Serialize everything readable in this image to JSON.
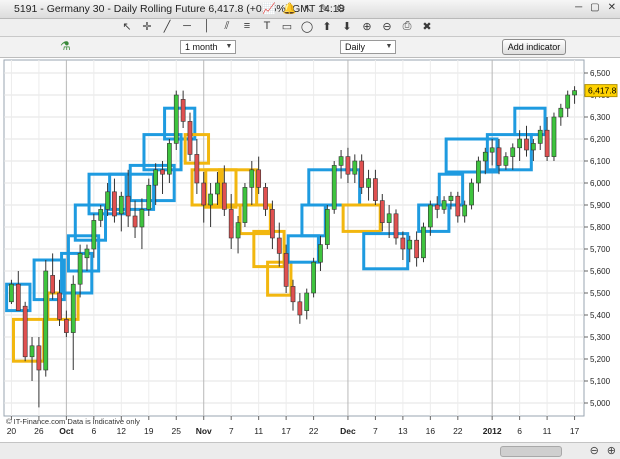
{
  "window": {
    "title": "5191 - Germany 30 - Daily Rolling Future   6,417.8 (+0.05%)   GMT 14:18",
    "close_glyph": "✕",
    "maximize_glyph": "▢",
    "minimize_glyph": "─"
  },
  "toolbar": {
    "period_select": "1 month",
    "interval_select": "Daily",
    "add_indicator_label": "Add indicator"
  },
  "footer": {
    "source_label": "© IT-Finance.com  Data is indicative only"
  },
  "chart_data": {
    "type": "candlestick",
    "last_price_label": "6,417.8",
    "ylim": [
      4950,
      6550
    ],
    "yticks": [
      "6,500",
      "6,400",
      "6,300",
      "6,200",
      "6,100",
      "6,000",
      "5,900",
      "5,800",
      "5,700",
      "5,600",
      "5,500",
      "5,400",
      "5,300",
      "5,200",
      "5,100",
      "5,000"
    ],
    "ytick_values": [
      6500,
      6400,
      6300,
      6200,
      6100,
      6000,
      5900,
      5800,
      5700,
      5600,
      5500,
      5400,
      5300,
      5200,
      5100,
      5000
    ],
    "xticks": [
      "20",
      "26",
      "Oct",
      "6",
      "12",
      "19",
      "25",
      "Nov",
      "7",
      "11",
      "17",
      "22",
      "Dec",
      "7",
      "13",
      "16",
      "22",
      "2012",
      "6",
      "11",
      "17"
    ],
    "xtick_index": [
      0,
      4,
      8,
      12,
      16,
      20,
      24,
      28,
      32,
      36,
      40,
      44,
      49,
      53,
      57,
      61,
      65,
      70,
      74,
      78,
      82
    ],
    "candles": [
      [
        5460,
        5560,
        5450,
        5540
      ],
      [
        5540,
        5600,
        5420,
        5420
      ],
      [
        5440,
        5460,
        5190,
        5210
      ],
      [
        5210,
        5300,
        5100,
        5260
      ],
      [
        5260,
        5300,
        4980,
        5150
      ],
      [
        5150,
        5650,
        5120,
        5600
      ],
      [
        5580,
        5680,
        5470,
        5500
      ],
      [
        5500,
        5560,
        5350,
        5380
      ],
      [
        5380,
        5420,
        5300,
        5320
      ],
      [
        5320,
        5580,
        5150,
        5540
      ],
      [
        5540,
        5720,
        5480,
        5680
      ],
      [
        5660,
        5720,
        5600,
        5700
      ],
      [
        5700,
        5860,
        5660,
        5830
      ],
      [
        5830,
        5900,
        5800,
        5880
      ],
      [
        5880,
        6000,
        5850,
        5960
      ],
      [
        5960,
        6020,
        5820,
        5850
      ],
      [
        5860,
        5960,
        5780,
        5940
      ],
      [
        5940,
        6060,
        5800,
        5850
      ],
      [
        5850,
        5920,
        5750,
        5800
      ],
      [
        5800,
        5930,
        5700,
        5880
      ],
      [
        5880,
        6020,
        5850,
        5990
      ],
      [
        5990,
        6090,
        5900,
        6060
      ],
      [
        6060,
        6100,
        5950,
        6040
      ],
      [
        6040,
        6200,
        6000,
        6180
      ],
      [
        6180,
        6420,
        6150,
        6400
      ],
      [
        6380,
        6420,
        6250,
        6280
      ],
      [
        6280,
        6320,
        6100,
        6130
      ],
      [
        6130,
        6200,
        5950,
        6000
      ],
      [
        6000,
        6050,
        5820,
        5900
      ],
      [
        5900,
        6000,
        5800,
        5950
      ],
      [
        5950,
        6050,
        5900,
        6000
      ],
      [
        6000,
        6080,
        5850,
        5880
      ],
      [
        5880,
        5950,
        5700,
        5750
      ],
      [
        5750,
        5850,
        5680,
        5820
      ],
      [
        5820,
        6000,
        5800,
        5980
      ],
      [
        5980,
        6100,
        5900,
        6060
      ],
      [
        6060,
        6120,
        5950,
        5980
      ],
      [
        5980,
        6000,
        5850,
        5880
      ],
      [
        5880,
        5920,
        5700,
        5750
      ],
      [
        5750,
        5820,
        5620,
        5680
      ],
      [
        5680,
        5720,
        5500,
        5530
      ],
      [
        5530,
        5560,
        5420,
        5460
      ],
      [
        5460,
        5500,
        5360,
        5400
      ],
      [
        5420,
        5520,
        5380,
        5500
      ],
      [
        5500,
        5660,
        5480,
        5640
      ],
      [
        5640,
        5760,
        5600,
        5720
      ],
      [
        5720,
        5900,
        5700,
        5880
      ],
      [
        5880,
        6100,
        5860,
        6080
      ],
      [
        6080,
        6150,
        6020,
        6120
      ],
      [
        6120,
        6160,
        6000,
        6040
      ],
      [
        6040,
        6130,
        6000,
        6100
      ],
      [
        6100,
        6130,
        5950,
        5980
      ],
      [
        5980,
        6060,
        5920,
        6020
      ],
      [
        6020,
        6060,
        5900,
        5920
      ],
      [
        5920,
        5950,
        5780,
        5820
      ],
      [
        5820,
        5900,
        5750,
        5860
      ],
      [
        5860,
        5880,
        5720,
        5750
      ],
      [
        5750,
        5780,
        5650,
        5700
      ],
      [
        5700,
        5760,
        5640,
        5740
      ],
      [
        5740,
        5780,
        5620,
        5660
      ],
      [
        5660,
        5820,
        5640,
        5800
      ],
      [
        5800,
        5920,
        5760,
        5900
      ],
      [
        5900,
        5940,
        5840,
        5880
      ],
      [
        5880,
        5940,
        5860,
        5920
      ],
      [
        5920,
        5960,
        5880,
        5940
      ],
      [
        5940,
        5960,
        5820,
        5850
      ],
      [
        5850,
        5920,
        5820,
        5900
      ],
      [
        5900,
        6020,
        5880,
        6000
      ],
      [
        6000,
        6120,
        5960,
        6100
      ],
      [
        6100,
        6160,
        6040,
        6140
      ],
      [
        6140,
        6200,
        6080,
        6160
      ],
      [
        6160,
        6200,
        6040,
        6080
      ],
      [
        6080,
        6140,
        6060,
        6120
      ],
      [
        6120,
        6180,
        6060,
        6160
      ],
      [
        6160,
        6240,
        6100,
        6200
      ],
      [
        6200,
        6260,
        6120,
        6150
      ],
      [
        6150,
        6200,
        6100,
        6180
      ],
      [
        6180,
        6260,
        6150,
        6240
      ],
      [
        6240,
        6300,
        6100,
        6120
      ],
      [
        6120,
        6320,
        6100,
        6300
      ],
      [
        6300,
        6360,
        6260,
        6340
      ],
      [
        6340,
        6420,
        6300,
        6400
      ],
      [
        6400,
        6440,
        6360,
        6420
      ]
    ],
    "boxes": [
      {
        "color": "#1e9be0",
        "i0": 0,
        "i1": 2,
        "lo": 5420,
        "hi": 5540
      },
      {
        "color": "#f2b70f",
        "i0": 1,
        "i1": 4,
        "lo": 5190,
        "hi": 5380
      },
      {
        "color": "#1e9be0",
        "i0": 4,
        "i1": 7,
        "lo": 5470,
        "hi": 5650
      },
      {
        "color": "#f2b70f",
        "i0": 6,
        "i1": 9,
        "lo": 5380,
        "hi": 5500
      },
      {
        "color": "#1e9be0",
        "i0": 8,
        "i1": 11,
        "lo": 5500,
        "hi": 5680
      },
      {
        "color": "#1e9be0",
        "i0": 9,
        "i1": 12,
        "lo": 5600,
        "hi": 5760
      },
      {
        "color": "#1e9be0",
        "i0": 10,
        "i1": 13,
        "lo": 5740,
        "hi": 5900
      },
      {
        "color": "#1e9be0",
        "i0": 12,
        "i1": 16,
        "lo": 5860,
        "hi": 6040
      },
      {
        "color": "#1e9be0",
        "i0": 15,
        "i1": 20,
        "lo": 5880,
        "hi": 6040
      },
      {
        "color": "#1e9be0",
        "i0": 18,
        "i1": 23,
        "lo": 5920,
        "hi": 6080
      },
      {
        "color": "#1e9be0",
        "i0": 20,
        "i1": 24,
        "lo": 6060,
        "hi": 6220
      },
      {
        "color": "#1e9be0",
        "i0": 23,
        "i1": 26,
        "lo": 6200,
        "hi": 6340
      },
      {
        "color": "#f2b70f",
        "i0": 26,
        "i1": 28,
        "lo": 6090,
        "hi": 6220
      },
      {
        "color": "#f2b70f",
        "i0": 27,
        "i1": 30,
        "lo": 5900,
        "hi": 6060
      },
      {
        "color": "#f2b70f",
        "i0": 29,
        "i1": 32,
        "lo": 5890,
        "hi": 6060
      },
      {
        "color": "#f2b70f",
        "i0": 31,
        "i1": 35,
        "lo": 5900,
        "hi": 6060
      },
      {
        "color": "#f2b70f",
        "i0": 34,
        "i1": 37,
        "lo": 5770,
        "hi": 5900
      },
      {
        "color": "#f2b70f",
        "i0": 36,
        "i1": 39,
        "lo": 5620,
        "hi": 5780
      },
      {
        "color": "#f2b70f",
        "i0": 38,
        "i1": 40,
        "lo": 5490,
        "hi": 5640
      },
      {
        "color": "#1e9be0",
        "i0": 41,
        "i1": 44,
        "lo": 5640,
        "hi": 5760
      },
      {
        "color": "#1e9be0",
        "i0": 43,
        "i1": 45,
        "lo": 5760,
        "hi": 5900
      },
      {
        "color": "#1e9be0",
        "i0": 44,
        "i1": 50,
        "lo": 5900,
        "hi": 6060
      },
      {
        "color": "#f2b70f",
        "i0": 49,
        "i1": 53,
        "lo": 5780,
        "hi": 5900
      },
      {
        "color": "#1e9be0",
        "i0": 52,
        "i1": 57,
        "lo": 5610,
        "hi": 5770
      },
      {
        "color": "#1e9be0",
        "i0": 60,
        "i1": 63,
        "lo": 5780,
        "hi": 5900
      },
      {
        "color": "#1e9be0",
        "i0": 63,
        "i1": 65,
        "lo": 5900,
        "hi": 6040
      },
      {
        "color": "#1e9be0",
        "i0": 64,
        "i1": 70,
        "lo": 6050,
        "hi": 6200
      },
      {
        "color": "#1e9be0",
        "i0": 70,
        "i1": 75,
        "lo": 6060,
        "hi": 6220
      },
      {
        "color": "#1e9be0",
        "i0": 74,
        "i1": 77,
        "lo": 6220,
        "hi": 6340
      }
    ]
  }
}
